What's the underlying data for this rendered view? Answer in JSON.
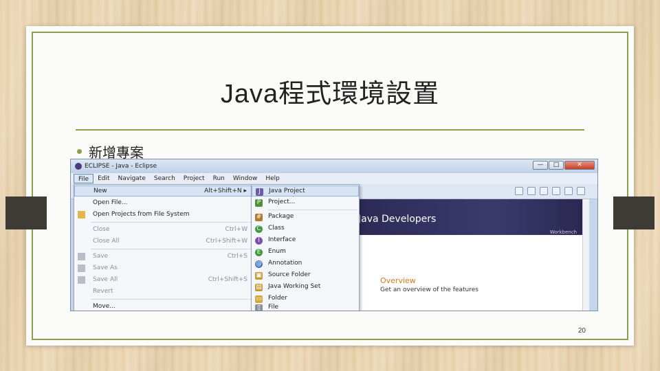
{
  "slide": {
    "title": "Java程式環境設置",
    "bullet": "新增專案",
    "page_number": "20"
  },
  "eclipse": {
    "window_title": "ECLIPSE - Java - Eclipse",
    "window_buttons": {
      "minimize": "—",
      "maximize": "□",
      "close": "✕"
    },
    "menubar": [
      "File",
      "Edit",
      "Navigate",
      "Search",
      "Project",
      "Run",
      "Window",
      "Help"
    ],
    "file_menu": [
      {
        "label": "New",
        "shortcut": "Alt+Shift+N ▸",
        "icon": ""
      },
      {
        "label": "Open File...",
        "shortcut": "",
        "icon": ""
      },
      {
        "label": "Open Projects from File System",
        "shortcut": "",
        "icon": "folder-icon"
      },
      {
        "label": "Close",
        "shortcut": "Ctrl+W",
        "icon": ""
      },
      {
        "label": "Close All",
        "shortcut": "Ctrl+Shift+W",
        "icon": ""
      },
      {
        "label": "Save",
        "shortcut": "Ctrl+S",
        "icon": "save-icon"
      },
      {
        "label": "Save As",
        "shortcut": "",
        "icon": "save-as-icon"
      },
      {
        "label": "Save All",
        "shortcut": "Ctrl+Shift+S",
        "icon": "save-all-icon"
      },
      {
        "label": "Revert",
        "shortcut": "",
        "icon": ""
      },
      {
        "label": "Move...",
        "shortcut": "",
        "icon": ""
      }
    ],
    "new_submenu": [
      {
        "label": "Java Project",
        "icon": "java-project-icon",
        "color": "#6b5aa8",
        "glyph": "J"
      },
      {
        "label": "Project...",
        "icon": "project-icon",
        "color": "#4e8f3a",
        "glyph": "P"
      },
      {
        "label": "Package",
        "icon": "package-icon",
        "color": "#b07a2a",
        "glyph": "#"
      },
      {
        "label": "Class",
        "icon": "class-icon",
        "color": "#3e9a3e",
        "glyph": "C"
      },
      {
        "label": "Interface",
        "icon": "interface-icon",
        "color": "#7a4fb0",
        "glyph": "I"
      },
      {
        "label": "Enum",
        "icon": "enum-icon",
        "color": "#3e9a3e",
        "glyph": "E"
      },
      {
        "label": "Annotation",
        "icon": "annotation-icon",
        "color": "#3b6fb6",
        "glyph": "@"
      },
      {
        "label": "Source Folder",
        "icon": "source-folder-icon",
        "color": "#c59b3a",
        "glyph": "▣"
      },
      {
        "label": "Java Working Set",
        "icon": "working-set-icon",
        "color": "#c59b3a",
        "glyph": "▤"
      },
      {
        "label": "Folder",
        "icon": "folder-icon",
        "color": "#d6a93c",
        "glyph": "▭"
      },
      {
        "label": "File",
        "icon": "file-icon",
        "color": "#8a8f99",
        "glyph": "▯"
      }
    ],
    "welcome": {
      "heading": "Java Developers",
      "workbench": "Workbench",
      "overview_title": "Overview",
      "overview_desc": "Get an overview of the features"
    }
  },
  "colors": {
    "accent_green": "#8aa04a",
    "overview_orange": "#d07a15",
    "welcome_header": "#2d2a55"
  }
}
